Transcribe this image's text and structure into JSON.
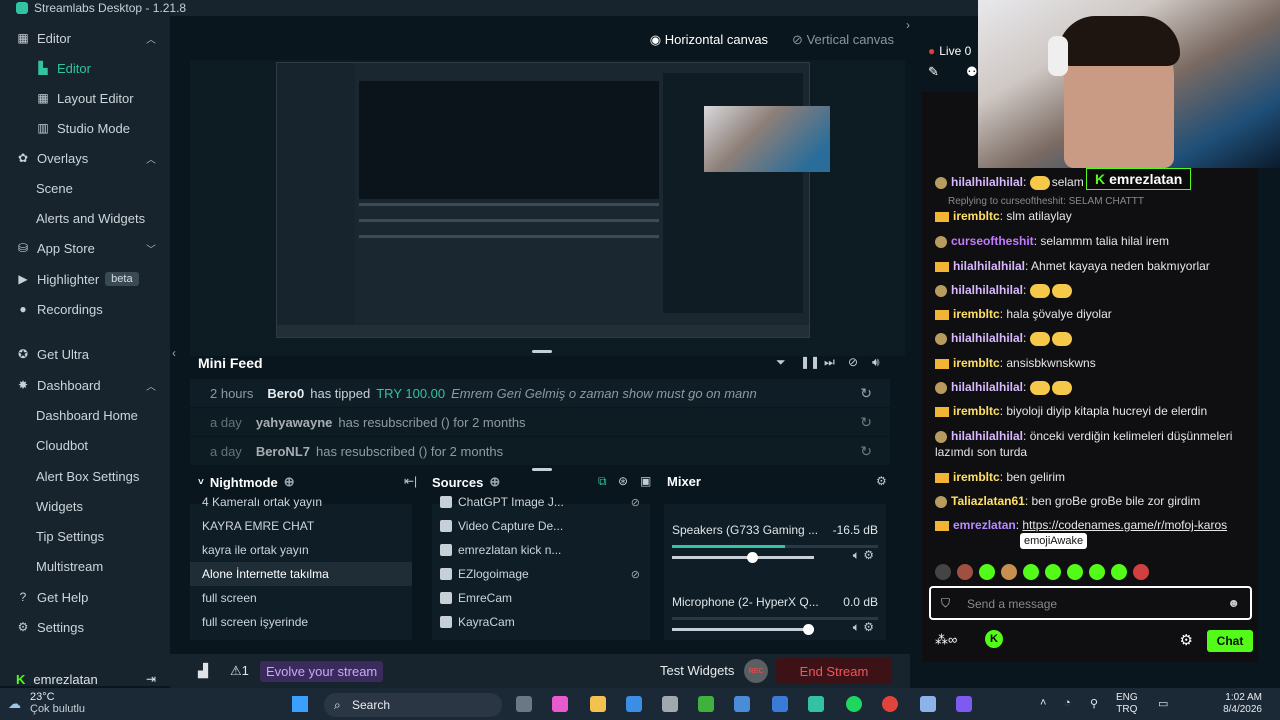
{
  "window": {
    "title": "Streamlabs Desktop - 1.21.8"
  },
  "sidebar": {
    "groups": [
      {
        "label": "Editor",
        "icon": "layout-icon",
        "expanded": true,
        "items": [
          "Editor",
          "Layout Editor",
          "Studio Mode"
        ]
      },
      {
        "label": "Overlays",
        "icon": "palette-icon",
        "expanded": true,
        "items": [
          "Scene",
          "Alerts and Widgets"
        ]
      },
      {
        "label": "App Store",
        "icon": "store-icon",
        "expanded": false,
        "items": []
      }
    ],
    "highlighter": {
      "label": "Highlighter",
      "badge": "beta"
    },
    "recordings": "Recordings",
    "get_ultra": "Get Ultra",
    "dashboard": {
      "label": "Dashboard",
      "items": [
        "Dashboard Home",
        "Cloudbot",
        "Alert Box Settings",
        "Widgets",
        "Tip Settings",
        "Multistream"
      ]
    },
    "get_help": "Get Help",
    "settings": "Settings",
    "user": "emrezlatan"
  },
  "canvas": {
    "horizontal": "Horizontal canvas",
    "vertical": "Vertical canvas"
  },
  "mini_feed": {
    "title": "Mini Feed",
    "rows": [
      {
        "time": "2 hours",
        "name": "Bero0",
        "action": "has tipped",
        "amount": "TRY 100.00",
        "message": "Emrem Geri Gelmiş o zaman show must go on mann"
      },
      {
        "time": "a day",
        "name": "yahyawayne",
        "action": "has resubscribed () for 2 months",
        "amount": "",
        "message": ""
      },
      {
        "time": "a day",
        "name": "BeroNL7",
        "action": "has resubscribed () for 2 months",
        "amount": "",
        "message": ""
      }
    ]
  },
  "scenes": {
    "title": "Nightmode",
    "items": [
      "4 Kameralı ortak yayın",
      "KAYRA EMRE CHAT",
      "kayra ile ortak yayın",
      "Alone İnternette takılma",
      "full screen",
      "full screen işyerinde"
    ],
    "selected_index": 3
  },
  "sources": {
    "title": "Sources",
    "items": [
      "ChatGPT Image J...",
      "Video Capture De...",
      "emrezlatan kick n...",
      "EZlogoimage",
      "EmreCam",
      "KayraCam"
    ]
  },
  "mixer": {
    "title": "Mixer",
    "channels": [
      {
        "name": "Speakers (G733 Gaming ...",
        "db": "-16.5 dB",
        "level": 0.55,
        "volume": 0.56
      },
      {
        "name": "Microphone (2- HyperX Q...",
        "db": "0.0 dB",
        "level": 0.0,
        "volume": 0.96
      }
    ]
  },
  "bottom_bar": {
    "alerts_count": "1",
    "evolve": "Evolve your stream",
    "test_widgets": "Test Widgets",
    "rec": "REC",
    "end_stream": "End Stream"
  },
  "chat": {
    "live_label": "Live 0",
    "reply_hint": "Replying to curseoftheshit: SELAM CHATTT",
    "messages": [
      {
        "user": "hilalhilalhilal",
        "color": "#d9b8ff",
        "text": "selam",
        "emotes": 1
      },
      {
        "user": "irembltc",
        "color": "#ffe066",
        "text": "slm atilaylay",
        "emotes": 0
      },
      {
        "user": "curseoftheshit",
        "color": "#c27bff",
        "text": "selammm talia hilal irem",
        "emotes": 0
      },
      {
        "user": "hilalhilalhilal",
        "color": "#d9b8ff",
        "text": "Ahmet kayaya neden bakmıyorlar",
        "emotes": 0
      },
      {
        "user": "hilalhilalhilal",
        "color": "#d9b8ff",
        "text": "",
        "emotes": 2
      },
      {
        "user": "irembltc",
        "color": "#ffe066",
        "text": "hala şövalye diyolar",
        "emotes": 0
      },
      {
        "user": "hilalhilalhilal",
        "color": "#d9b8ff",
        "text": "",
        "emotes": 2
      },
      {
        "user": "irembltc",
        "color": "#ffe066",
        "text": "ansisbkwnskwns",
        "emotes": 0
      },
      {
        "user": "hilalhilalhilal",
        "color": "#d9b8ff",
        "text": "",
        "emotes": 2
      },
      {
        "user": "irembltc",
        "color": "#ffe066",
        "text": "biyoloji diyip kitapla hucreyi de elerdin",
        "emotes": 0
      },
      {
        "user": "hilalhilalhilal",
        "color": "#d9b8ff",
        "text": "önceki verdiğin kelimeleri düşünmeleri lazımdı son turda",
        "emotes": 0
      },
      {
        "user": "irembltc",
        "color": "#ffe066",
        "text": "ben gelirim",
        "emotes": 0
      },
      {
        "user": "Taliazlatan61",
        "color": "#ffe066",
        "text": "ben groBe groBe bile zor girdim",
        "emotes": 0
      },
      {
        "user": "emrezlatan",
        "color": "#b58cff",
        "text": "https://codenames.game/r/mofoj-karos",
        "emotes": 0
      }
    ],
    "tooltip": "emojiAwake",
    "input_placeholder": "Send a message",
    "send_label": "Chat",
    "overlay_name": "emrezlatan"
  },
  "taskbar": {
    "weather_temp": "23°C",
    "weather_desc": "Çok bulutlu",
    "search": "Search",
    "lang": "ENG",
    "locale": "TRQ",
    "time": "1:02 AM",
    "date": "8/4/2026"
  }
}
